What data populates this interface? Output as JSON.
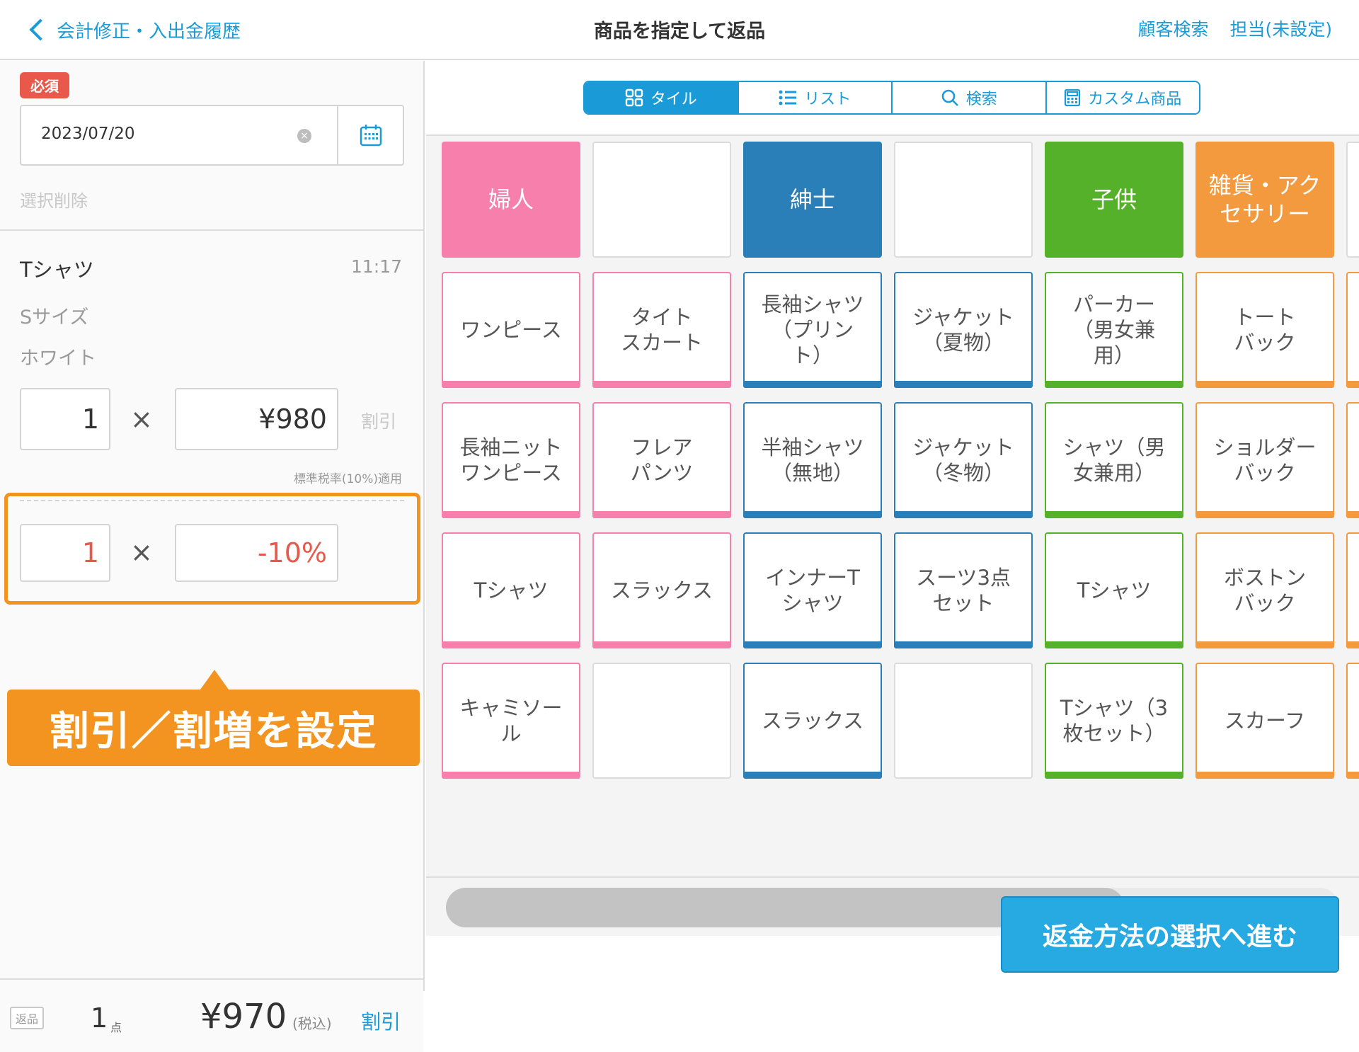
{
  "header": {
    "back_label": "会計修正・入出金履歴",
    "title": "商品を指定して返品",
    "customer_search": "顧客検索",
    "staff": "担当(未設定)"
  },
  "left": {
    "required_badge": "必須",
    "date_value": "2023/07/20",
    "select_delete": "選択削除",
    "item": {
      "name": "Tシャツ",
      "time": "11:17",
      "size": "Sサイズ",
      "color": "ホワイト",
      "quantity": "1",
      "times": "×",
      "price": "¥980",
      "discount_link": "割引",
      "tax_note": "標準税率(10%)適用",
      "discount_quantity": "1",
      "discount_value": "-10%"
    },
    "callout": "割引／割増を設定",
    "footer": {
      "return_badge": "返品",
      "count": "1",
      "count_unit": "点",
      "total": "¥970",
      "tax_included": "(税込)",
      "discount": "割引"
    }
  },
  "right": {
    "tabs": [
      {
        "label": "タイル",
        "icon": "grid-icon",
        "active": true
      },
      {
        "label": "リスト",
        "icon": "list-icon",
        "active": false
      },
      {
        "label": "検索",
        "icon": "search-icon",
        "active": false
      },
      {
        "label": "カスタム商品",
        "icon": "calculator-icon",
        "active": false
      }
    ],
    "colors": {
      "pink": "#f77fac",
      "blue": "#2a7fb8",
      "green": "#55b02a",
      "orange": "#f39a3f",
      "accent": "#1a9bd7"
    },
    "tiles": [
      [
        {
          "label": "婦人",
          "type": "category",
          "color": "pink"
        },
        {
          "label": "",
          "type": "empty"
        },
        {
          "label": "紳士",
          "type": "category",
          "color": "blue"
        },
        {
          "label": "",
          "type": "empty"
        },
        {
          "label": "子供",
          "type": "category",
          "color": "green"
        },
        {
          "label": "雑貨・アク\nセサリー",
          "type": "category",
          "color": "orange"
        }
      ],
      [
        {
          "label": "ワンピース",
          "type": "product",
          "color": "pink"
        },
        {
          "label": "タイト\nスカート",
          "type": "product",
          "color": "pink"
        },
        {
          "label": "長袖シャツ\n（プリン\nト）",
          "type": "product",
          "color": "blue"
        },
        {
          "label": "ジャケット\n（夏物）",
          "type": "product",
          "color": "blue"
        },
        {
          "label": "パーカー\n（男女兼\n用）",
          "type": "product",
          "color": "green"
        },
        {
          "label": "トート\nバック",
          "type": "product",
          "color": "orange"
        }
      ],
      [
        {
          "label": "長袖ニット\nワンピース",
          "type": "product",
          "color": "pink"
        },
        {
          "label": "フレア\nパンツ",
          "type": "product",
          "color": "pink"
        },
        {
          "label": "半袖シャツ\n（無地）",
          "type": "product",
          "color": "blue"
        },
        {
          "label": "ジャケット\n（冬物）",
          "type": "product",
          "color": "blue"
        },
        {
          "label": "シャツ（男\n女兼用）",
          "type": "product",
          "color": "green"
        },
        {
          "label": "ショルダー\nバック",
          "type": "product",
          "color": "orange"
        }
      ],
      [
        {
          "label": "Tシャツ",
          "type": "product",
          "color": "pink"
        },
        {
          "label": "スラックス",
          "type": "product",
          "color": "pink"
        },
        {
          "label": "インナーT\nシャツ",
          "type": "product",
          "color": "blue"
        },
        {
          "label": "スーツ3点\nセット",
          "type": "product",
          "color": "blue"
        },
        {
          "label": "Tシャツ",
          "type": "product",
          "color": "green"
        },
        {
          "label": "ボストン\nバック",
          "type": "product",
          "color": "orange"
        }
      ],
      [
        {
          "label": "キャミソー\nル",
          "type": "product",
          "color": "pink"
        },
        {
          "label": "",
          "type": "empty"
        },
        {
          "label": "スラックス",
          "type": "product",
          "color": "blue"
        },
        {
          "label": "",
          "type": "empty"
        },
        {
          "label": "Tシャツ（3\n枚セット）",
          "type": "product",
          "color": "green"
        },
        {
          "label": "スカーフ",
          "type": "product",
          "color": "orange"
        }
      ]
    ],
    "scroll_position": 0.76,
    "proceed_button": "返金方法の選択へ進む"
  }
}
